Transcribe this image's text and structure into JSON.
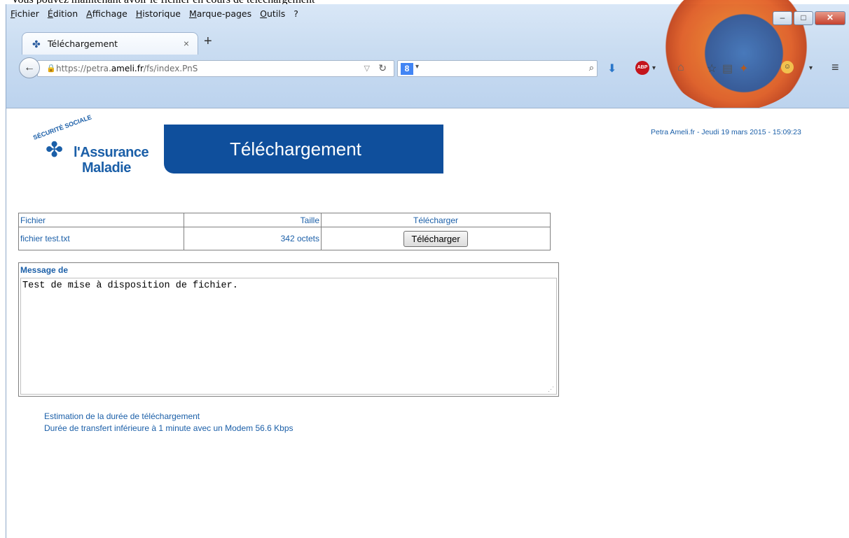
{
  "menu": [
    "Fichier",
    "Édition",
    "Affichage",
    "Historique",
    "Marque-pages",
    "Outils",
    "?"
  ],
  "tab": {
    "title": "Téléchargement",
    "close": "×",
    "new_tab": "+"
  },
  "url": {
    "prefix": "https://petra.",
    "domain": "ameli.fr",
    "path": "/fs/index.PnS"
  },
  "search": {
    "engine": "8",
    "placeholder": ""
  },
  "toolbar": {
    "abp": "ABP"
  },
  "window_controls": {
    "minimize": "–",
    "maximize": "□",
    "close": "✕"
  },
  "logo": {
    "seal": "SÉCURITÉ SOCIALE",
    "line1": "l'Assurance",
    "line2": "Maladie"
  },
  "banner": {
    "title": "Téléchargement"
  },
  "stamp": "Petra Ameli.fr - Jeudi 19 mars 2015 - 15:09:23",
  "table": {
    "headers": [
      "Fichier",
      "Taille",
      "Télécharger"
    ],
    "rows": [
      {
        "file": "fichier test.txt",
        "size": "342 octets",
        "button": "Télécharger"
      }
    ]
  },
  "message": {
    "label": "Message de",
    "text": "Test de mise à disposition de fichier."
  },
  "estimation": {
    "line1": "Estimation de la durée de téléchargement",
    "line2": "Durée de transfert inférieure à 1 minute avec un Modem 56.6 Kbps"
  },
  "colors": {
    "accent": "#0f4f9c",
    "text_blue": "#1b5fa8"
  }
}
